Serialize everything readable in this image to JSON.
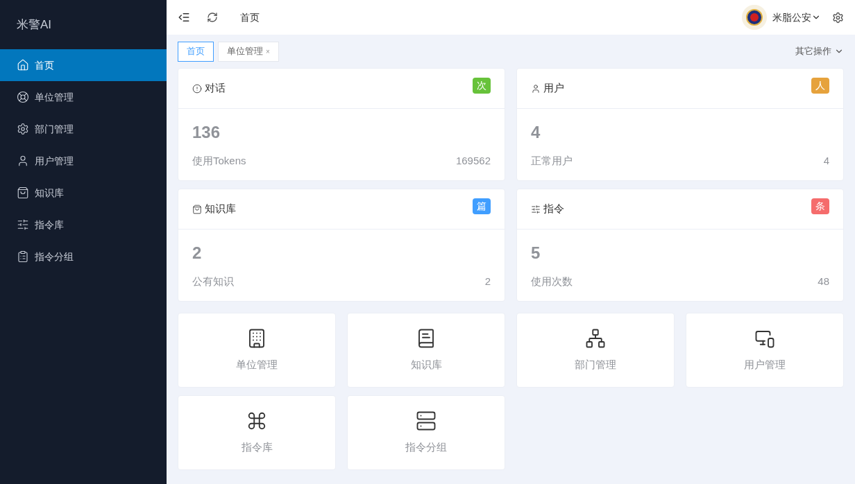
{
  "brand": "米警AI",
  "sidebar": {
    "items": [
      {
        "label": "首页",
        "kind": "home",
        "selected": true
      },
      {
        "label": "单位管理",
        "kind": "lifebuoy",
        "selected": false
      },
      {
        "label": "部门管理",
        "kind": "gear",
        "selected": false
      },
      {
        "label": "用户管理",
        "kind": "user",
        "selected": false
      },
      {
        "label": "知识库",
        "kind": "bag",
        "selected": false
      },
      {
        "label": "指令库",
        "kind": "sliders",
        "selected": false
      },
      {
        "label": "指令分组",
        "kind": "clipboard",
        "selected": false
      }
    ]
  },
  "header": {
    "breadcrumb": "首页",
    "user": "米脂公安"
  },
  "tabs": [
    {
      "label": "首页",
      "selected": true
    },
    {
      "label": "单位管理",
      "selected": false,
      "close": "×"
    }
  ],
  "other_actions": "其它操作",
  "stats": [
    {
      "title": "对话",
      "kind": "alert",
      "badge": "次",
      "color": "#67c23a",
      "value": "136",
      "label": "使用Tokens",
      "total": "169562"
    },
    {
      "title": "用户",
      "kind": "user",
      "badge": "人",
      "color": "#e6a23c",
      "value": "4",
      "label": "正常用户",
      "total": "4"
    },
    {
      "title": "知识库",
      "kind": "bag",
      "badge": "篇",
      "color": "#409eff",
      "value": "2",
      "label": "公有知识",
      "total": "2"
    },
    {
      "title": "指令",
      "kind": "sliders",
      "badge": "条",
      "color": "#f56c6c",
      "value": "5",
      "label": "使用次数",
      "total": "48"
    }
  ],
  "shortcuts": [
    {
      "label": "单位管理",
      "kind": "building"
    },
    {
      "label": "知识库",
      "kind": "book"
    },
    {
      "label": "部门管理",
      "kind": "network"
    },
    {
      "label": "用户管理",
      "kind": "monitor"
    },
    {
      "label": "指令库",
      "kind": "command"
    },
    {
      "label": "指令分组",
      "kind": "server"
    }
  ]
}
